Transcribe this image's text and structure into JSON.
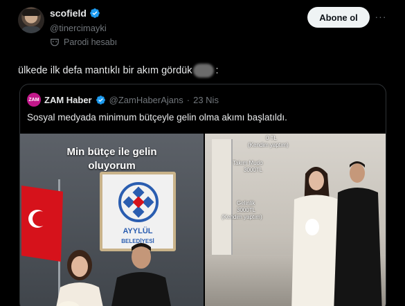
{
  "author": {
    "display_name": "scofield",
    "handle": "@tinercimayki",
    "parody_label": "Parodi hesabı",
    "verified_color": "#1d9bf0"
  },
  "actions": {
    "follow_label": "Abone ol",
    "more_label": "···"
  },
  "tweet": {
    "text_before": "ülkede ilk defa mantıklı bir akım gördük",
    "text_after": ":"
  },
  "quote": {
    "logo_text": "ZAM",
    "name": "ZAM Haber",
    "handle": "@ZamHaberAjans",
    "separator": "·",
    "date": "23 Nis",
    "text": "Sosyal medyada minimum bütçeyle gelin olma akımı başlatıldı.",
    "logo_color": "#c2188b"
  },
  "media": {
    "left": {
      "overlay_line1": "Min bütçe ile gelin",
      "overlay_line2": "oluyorum",
      "sign_text_1": "AYYLÜL",
      "sign_text_2": "BELEDİYESİ"
    },
    "right": {
      "labels": [
        "0 TL",
        "(Kendim yaptım)",
        "Takım Mudo",
        "3000TL",
        "Gelinlik",
        "3000TL",
        "(Kendim yaptım)"
      ]
    }
  }
}
